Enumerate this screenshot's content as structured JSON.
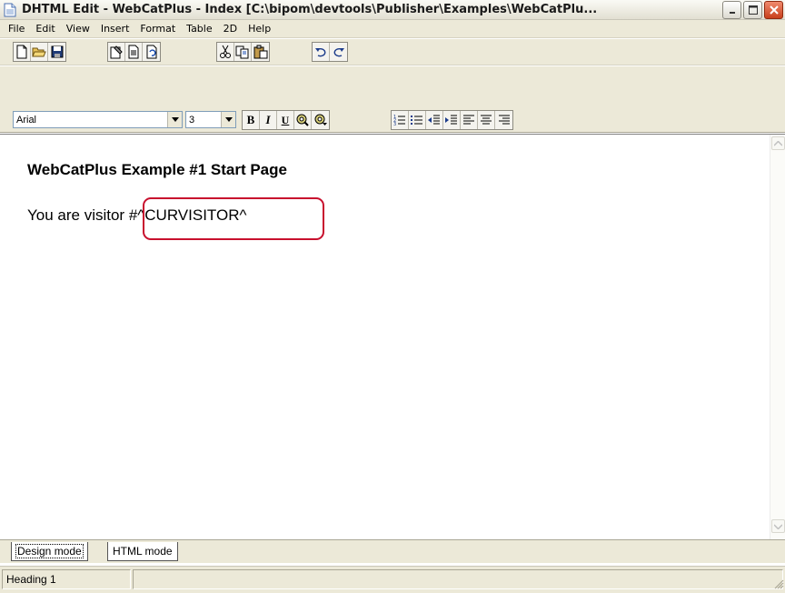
{
  "window": {
    "title": "DHTML Edit - WebCatPlus - Index [C:\\bipom\\devtools\\Publisher\\Examples\\WebCatPlu...",
    "icon": "document-icon",
    "controls": [
      "minimize-icon",
      "maximize-icon",
      "close-icon"
    ]
  },
  "menu": {
    "items": [
      "File",
      "Edit",
      "View",
      "Insert",
      "Format",
      "Table",
      "2D",
      "Help"
    ]
  },
  "toolbar_standard": {
    "buttons": [
      "new-document-icon",
      "open-folder-icon",
      "save-disk-icon",
      "properties-icon",
      "page-icon",
      "refresh-icon",
      "cut-icon",
      "copy-icon",
      "paste-icon",
      "undo-icon",
      "redo-icon"
    ]
  },
  "toolbar_format": {
    "font_name": "Arial",
    "font_size": "3",
    "buttons": [
      "bold-icon",
      "italic-icon",
      "underline-icon",
      "text-color-icon",
      "highlight-color-icon",
      "numbered-list-icon",
      "bulleted-list-icon",
      "outdent-icon",
      "indent-icon",
      "align-left-icon",
      "align-center-icon",
      "align-right-icon"
    ],
    "bold_label": "B",
    "italic_label": "I",
    "underline_label": "U"
  },
  "document": {
    "heading": "WebCatPlus Example #1 Start Page",
    "line_prefix": "You are visitor",
    "variable": "#^CURVISITOR^",
    "highlight_color": "#c8102e"
  },
  "tabs": {
    "design": "Design mode",
    "html": "HTML mode"
  },
  "status": {
    "style": "Heading 1",
    "secondary": ""
  }
}
